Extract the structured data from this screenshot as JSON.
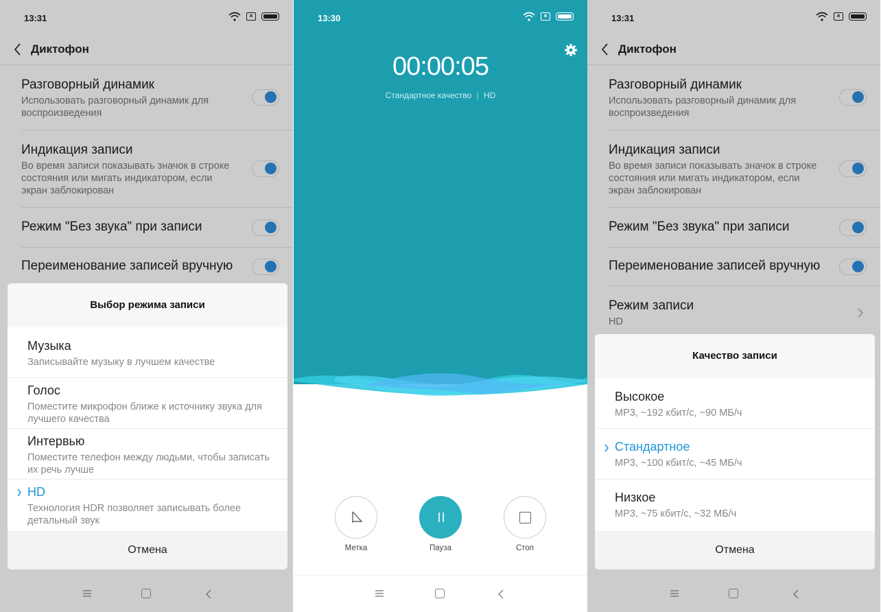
{
  "statusbar_left_time": "13:31",
  "statusbar_mid_time": "13:30",
  "app_title": "Диктофон",
  "settings": [
    {
      "title": "Разговорный динамик",
      "subtitle": "Использовать разговорный динамик для воспроизведения",
      "toggle_on": true
    },
    {
      "title": "Индикация записи",
      "subtitle": "Во время записи показывать значок в строке состояния или мигать индикатором, если экран заблокирован",
      "toggle_on": true
    },
    {
      "title": "Режим \"Без звука\" при записи",
      "subtitle": "",
      "toggle_on": true
    },
    {
      "title": "Переименование записей вручную",
      "subtitle": "",
      "toggle_on": true
    }
  ],
  "record_mode_row": {
    "title": "Режим записи",
    "value": "HD"
  },
  "mode_sheet": {
    "title": "Выбор режима записи",
    "options": [
      {
        "title": "Музыка",
        "subtitle": "Записывайте музыку в лучшем качестве",
        "selected": false
      },
      {
        "title": "Голос",
        "subtitle": "Поместите микрофон ближе к источнику звука для лучшего качества",
        "selected": false
      },
      {
        "title": "Интервью",
        "subtitle": "Поместите телефон между людьми, чтобы записать их речь лучше",
        "selected": false
      },
      {
        "title": "HD",
        "subtitle": "Технология HDR позволяет записывать более детальный звук",
        "selected": true
      }
    ],
    "cancel": "Отмена"
  },
  "quality_sheet": {
    "title": "Качество записи",
    "options": [
      {
        "title": "Высокое",
        "subtitle": "MP3, ~192 кбит/с, ~90 МБ/ч",
        "selected": false
      },
      {
        "title": "Стандартное",
        "subtitle": "MP3, ~100 кбит/с, ~45 МБ/ч",
        "selected": true
      },
      {
        "title": "Низкое",
        "subtitle": "MP3, ~75 кбит/с, ~32 МБ/ч",
        "selected": false
      }
    ],
    "cancel": "Отмена"
  },
  "recorder": {
    "timer": "00:00:05",
    "quality_label": "Стандартное качество",
    "quality_hd": "HD",
    "mark_label": "Метка",
    "pause_label": "Пауза",
    "stop_label": "Стоп"
  },
  "colors": {
    "accent": "#1e97d6",
    "recorder_bg": "#1c9eaf",
    "toggle": "#2f8fe0"
  }
}
